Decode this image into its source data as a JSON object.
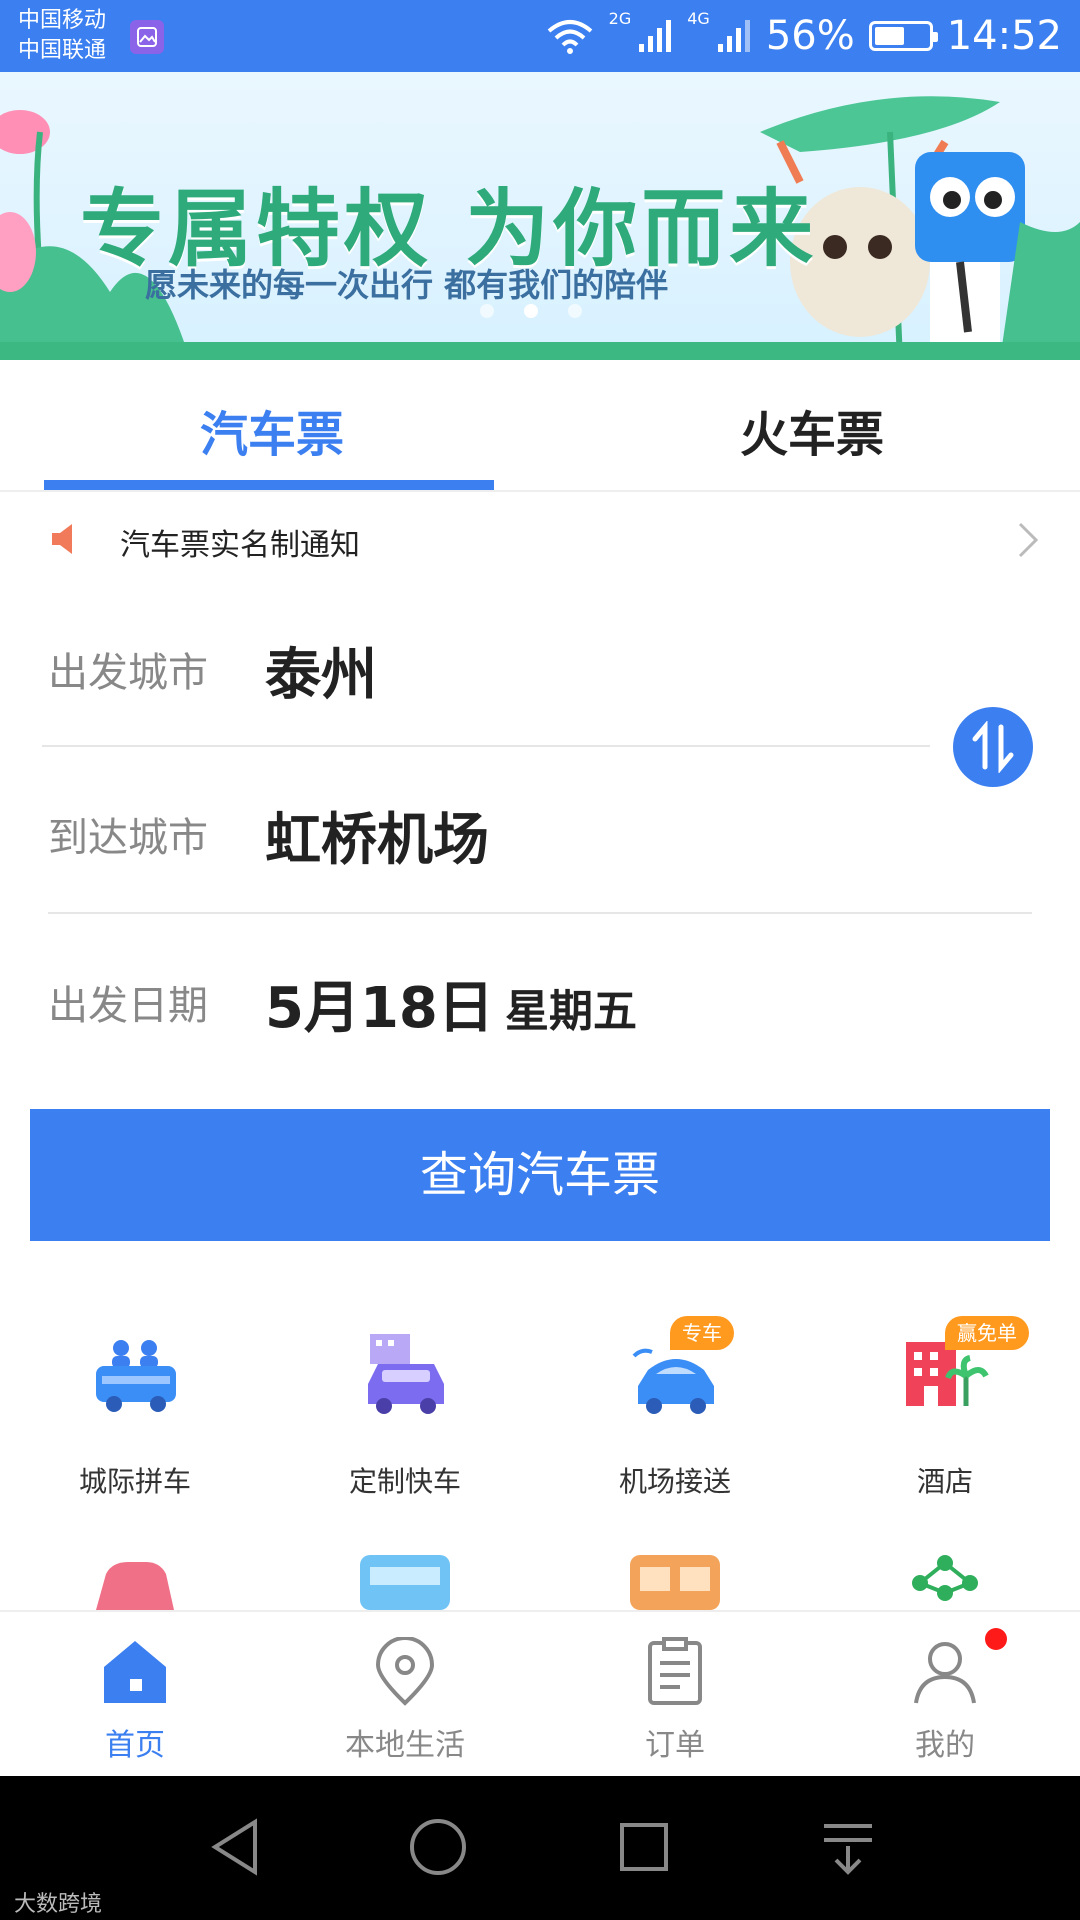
{
  "status_bar": {
    "carrier_1": "中国移动",
    "carrier_2": "中国联通",
    "net_2g": "2G",
    "net_4g": "4G",
    "battery_percent": "56%",
    "battery_level": 0.56,
    "time": "14:52"
  },
  "banner": {
    "title": "专属特权 为你而来",
    "subtitle": "愿未来的每一次出行 都有我们的陪伴"
  },
  "tabs": {
    "bus": "汽车票",
    "train": "火车票",
    "active": "bus"
  },
  "notice": {
    "text": "汽车票实名制通知"
  },
  "form": {
    "departure_label": "出发城市",
    "departure_value": "泰州",
    "arrival_label": "到达城市",
    "arrival_value": "虹桥机场",
    "date_label": "出发日期",
    "date_value": "5月18日",
    "weekday": "星期五"
  },
  "query_button": "查询汽车票",
  "services": [
    {
      "label": "城际拼车",
      "icon": "carpool-icon"
    },
    {
      "label": "定制快车",
      "icon": "express-car-icon"
    },
    {
      "label": "机场接送",
      "icon": "airport-transfer-icon",
      "badge": "专车"
    },
    {
      "label": "酒店",
      "icon": "hotel-icon",
      "badge": "赢免单"
    }
  ],
  "bottom_nav": [
    {
      "label": "首页",
      "icon": "home-icon"
    },
    {
      "label": "本地生活",
      "icon": "location-pin-icon"
    },
    {
      "label": "订单",
      "icon": "order-icon"
    },
    {
      "label": "我的",
      "icon": "profile-icon"
    }
  ],
  "colors": {
    "primary": "#3b7ff0",
    "badge_orange": "#ff9a1f",
    "notify_red": "#ff1a1a"
  },
  "watermark": "大数跨境"
}
